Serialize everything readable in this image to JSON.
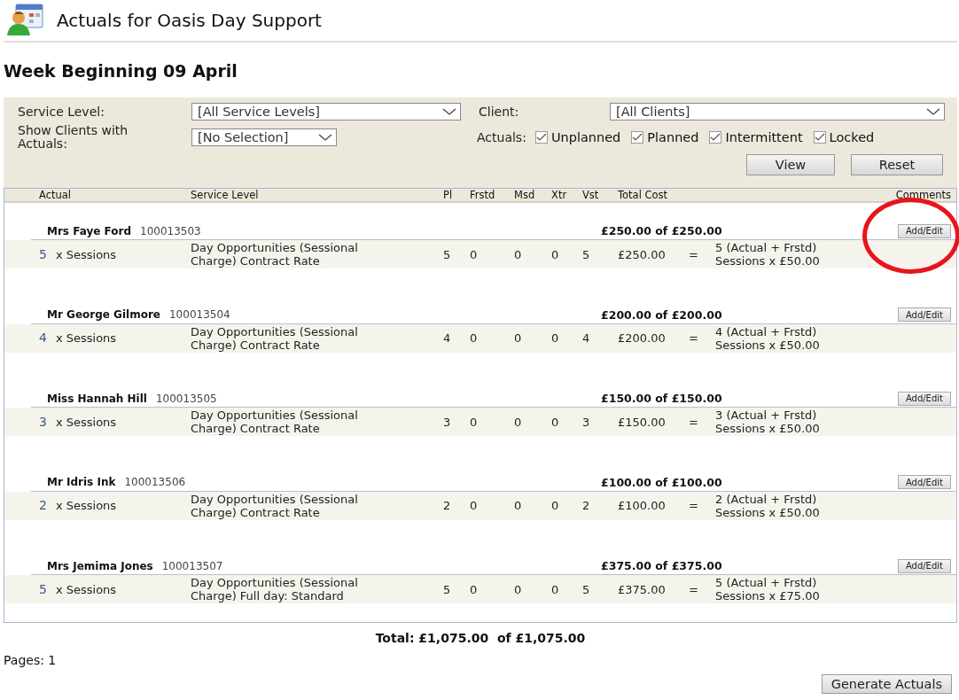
{
  "page": {
    "title": "Actuals for Oasis Day Support"
  },
  "heading": "Week Beginning 09 April",
  "filters": {
    "service_level": {
      "label": "Service Level:",
      "value": "[All Service Levels]"
    },
    "client": {
      "label": "Client:",
      "value": "[All Clients]"
    },
    "show_clients": {
      "label": "Show Clients with Actuals:",
      "value": "[No Selection]"
    },
    "actuals": {
      "label": "Actuals:",
      "options": [
        {
          "label": "Unplanned",
          "checked": true
        },
        {
          "label": "Planned",
          "checked": true
        },
        {
          "label": "Intermittent",
          "checked": true
        },
        {
          "label": "Locked",
          "checked": true
        }
      ]
    },
    "buttons": [
      "View",
      "Reset"
    ]
  },
  "table": {
    "columns": [
      "Actual",
      "Service Level",
      "Pl",
      "Frstd",
      "Msd",
      "Xtr",
      "Vst",
      "Total Cost",
      "Comments"
    ],
    "clients": [
      {
        "name": "Mrs Faye Ford",
        "id": "100013503",
        "total": "£250.00 of £250.00",
        "button": "Add/Edit",
        "circled": true,
        "lines": [
          {
            "qty": "5",
            "unit": "x Sessions",
            "service_level": "Day Opportunities (Sessional Charge) Contract Rate",
            "pl": "5",
            "frstd": "0",
            "msd": "0",
            "xtr": "0",
            "vst": "5",
            "cost": "£250.00",
            "equals": "=",
            "formula": "5 (Actual + Frstd) Sessions x £50.00"
          }
        ]
      },
      {
        "name": "Mr George Gilmore",
        "id": "100013504",
        "total": "£200.00 of £200.00",
        "button": "Add/Edit",
        "circled": false,
        "lines": [
          {
            "qty": "4",
            "unit": "x Sessions",
            "service_level": "Day Opportunities (Sessional Charge) Contract Rate",
            "pl": "4",
            "frstd": "0",
            "msd": "0",
            "xtr": "0",
            "vst": "4",
            "cost": "£200.00",
            "equals": "=",
            "formula": "4 (Actual + Frstd) Sessions x £50.00"
          }
        ]
      },
      {
        "name": "Miss Hannah Hill",
        "id": "100013505",
        "total": "£150.00 of £150.00",
        "button": "Add/Edit",
        "circled": false,
        "lines": [
          {
            "qty": "3",
            "unit": "x Sessions",
            "service_level": "Day Opportunities (Sessional Charge) Contract Rate",
            "pl": "3",
            "frstd": "0",
            "msd": "0",
            "xtr": "0",
            "vst": "3",
            "cost": "£150.00",
            "equals": "=",
            "formula": "3 (Actual + Frstd) Sessions x £50.00"
          }
        ]
      },
      {
        "name": "Mr Idris Ink",
        "id": "100013506",
        "total": "£100.00 of £100.00",
        "button": "Add/Edit",
        "circled": false,
        "lines": [
          {
            "qty": "2",
            "unit": "x Sessions",
            "service_level": "Day Opportunities (Sessional Charge) Contract Rate",
            "pl": "2",
            "frstd": "0",
            "msd": "0",
            "xtr": "0",
            "vst": "2",
            "cost": "£100.00",
            "equals": "=",
            "formula": "2 (Actual + Frstd) Sessions x £50.00"
          }
        ]
      },
      {
        "name": "Mrs Jemima Jones",
        "id": "100013507",
        "total": "£375.00 of £375.00",
        "button": "Add/Edit",
        "circled": false,
        "lines": [
          {
            "qty": "5",
            "unit": "x Sessions",
            "service_level": "Day Opportunities (Sessional Charge) Full day: Standard",
            "pl": "5",
            "frstd": "0",
            "msd": "0",
            "xtr": "0",
            "vst": "5",
            "cost": "£375.00",
            "equals": "=",
            "formula": "5 (Actual + Frstd) Sessions x £75.00"
          }
        ]
      }
    ]
  },
  "total": "Total: £1,075.00  of £1,075.00",
  "pages": "Pages: 1",
  "generate_button": "Generate Actuals"
}
